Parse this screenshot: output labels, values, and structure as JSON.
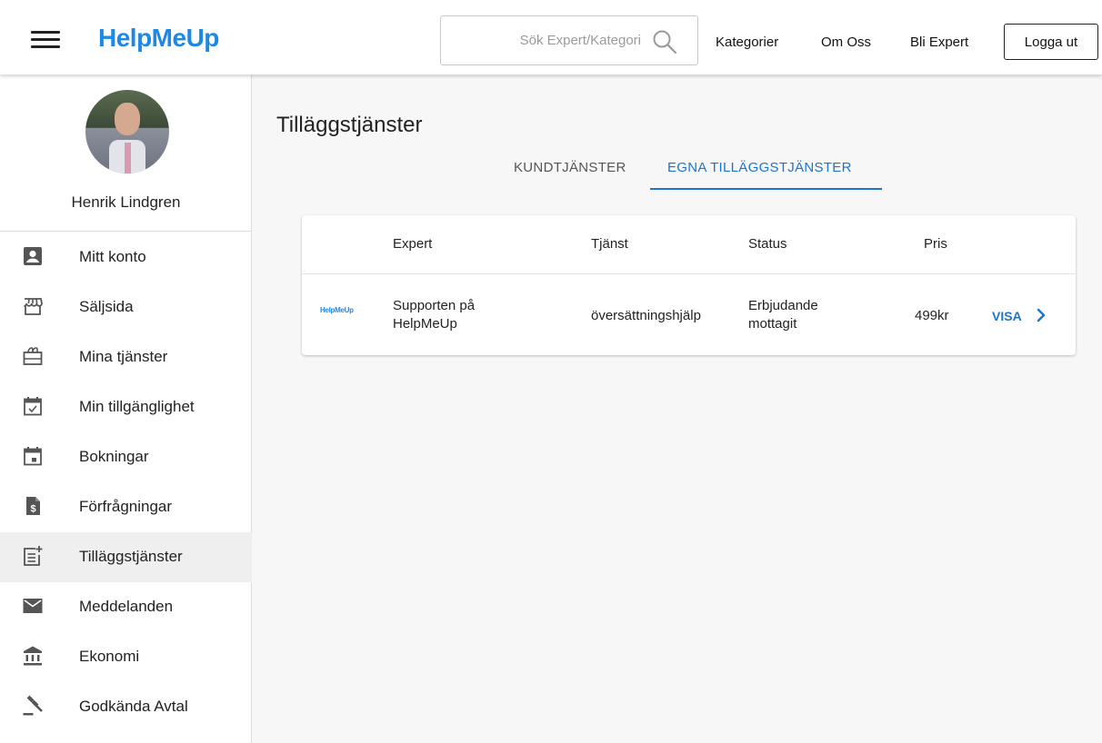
{
  "header": {
    "logo": "HelpMeUp",
    "search_placeholder": "Sök Expert/Kategori",
    "nav": [
      "Kategorier",
      "Om Oss",
      "Bli Expert"
    ],
    "logout_label": "Logga ut"
  },
  "sidebar": {
    "user_name": "Henrik Lindgren",
    "items": [
      {
        "label": "Mitt konto",
        "icon": "account-box-icon"
      },
      {
        "label": "Säljsida",
        "icon": "storefront-icon"
      },
      {
        "label": "Mina tjänster",
        "icon": "services-icon"
      },
      {
        "label": "Min tillgänglighet",
        "icon": "calendar-check-icon"
      },
      {
        "label": "Bokningar",
        "icon": "calendar-icon"
      },
      {
        "label": "Förfrågningar",
        "icon": "request-document-icon"
      },
      {
        "label": "Tilläggstjänster",
        "icon": "post-add-icon",
        "active": true
      },
      {
        "label": "Meddelanden",
        "icon": "mail-icon"
      },
      {
        "label": "Ekonomi",
        "icon": "bank-icon"
      },
      {
        "label": "Godkända Avtal",
        "icon": "gavel-icon"
      }
    ]
  },
  "main": {
    "title": "Tilläggstjänster",
    "tabs": [
      {
        "label": "KUNDTJÄNSTER",
        "active": false
      },
      {
        "label": "EGNA TILLÄGGSTJÄNSTER",
        "active": true
      }
    ],
    "table": {
      "headers": [
        "Expert",
        "Tjänst",
        "Status",
        "Pris"
      ],
      "rows": [
        {
          "logo": "HelpMeUp",
          "expert": [
            "Supporten på",
            "HelpMeUp"
          ],
          "service": "översättningshjälp",
          "status": [
            "Erbjudande",
            "mottagit"
          ],
          "price": "499kr",
          "action": "VISA"
        }
      ]
    }
  },
  "colors": {
    "brand": "#1e88e5",
    "accent": "#1e74c8",
    "active_bg": "#efefef"
  }
}
